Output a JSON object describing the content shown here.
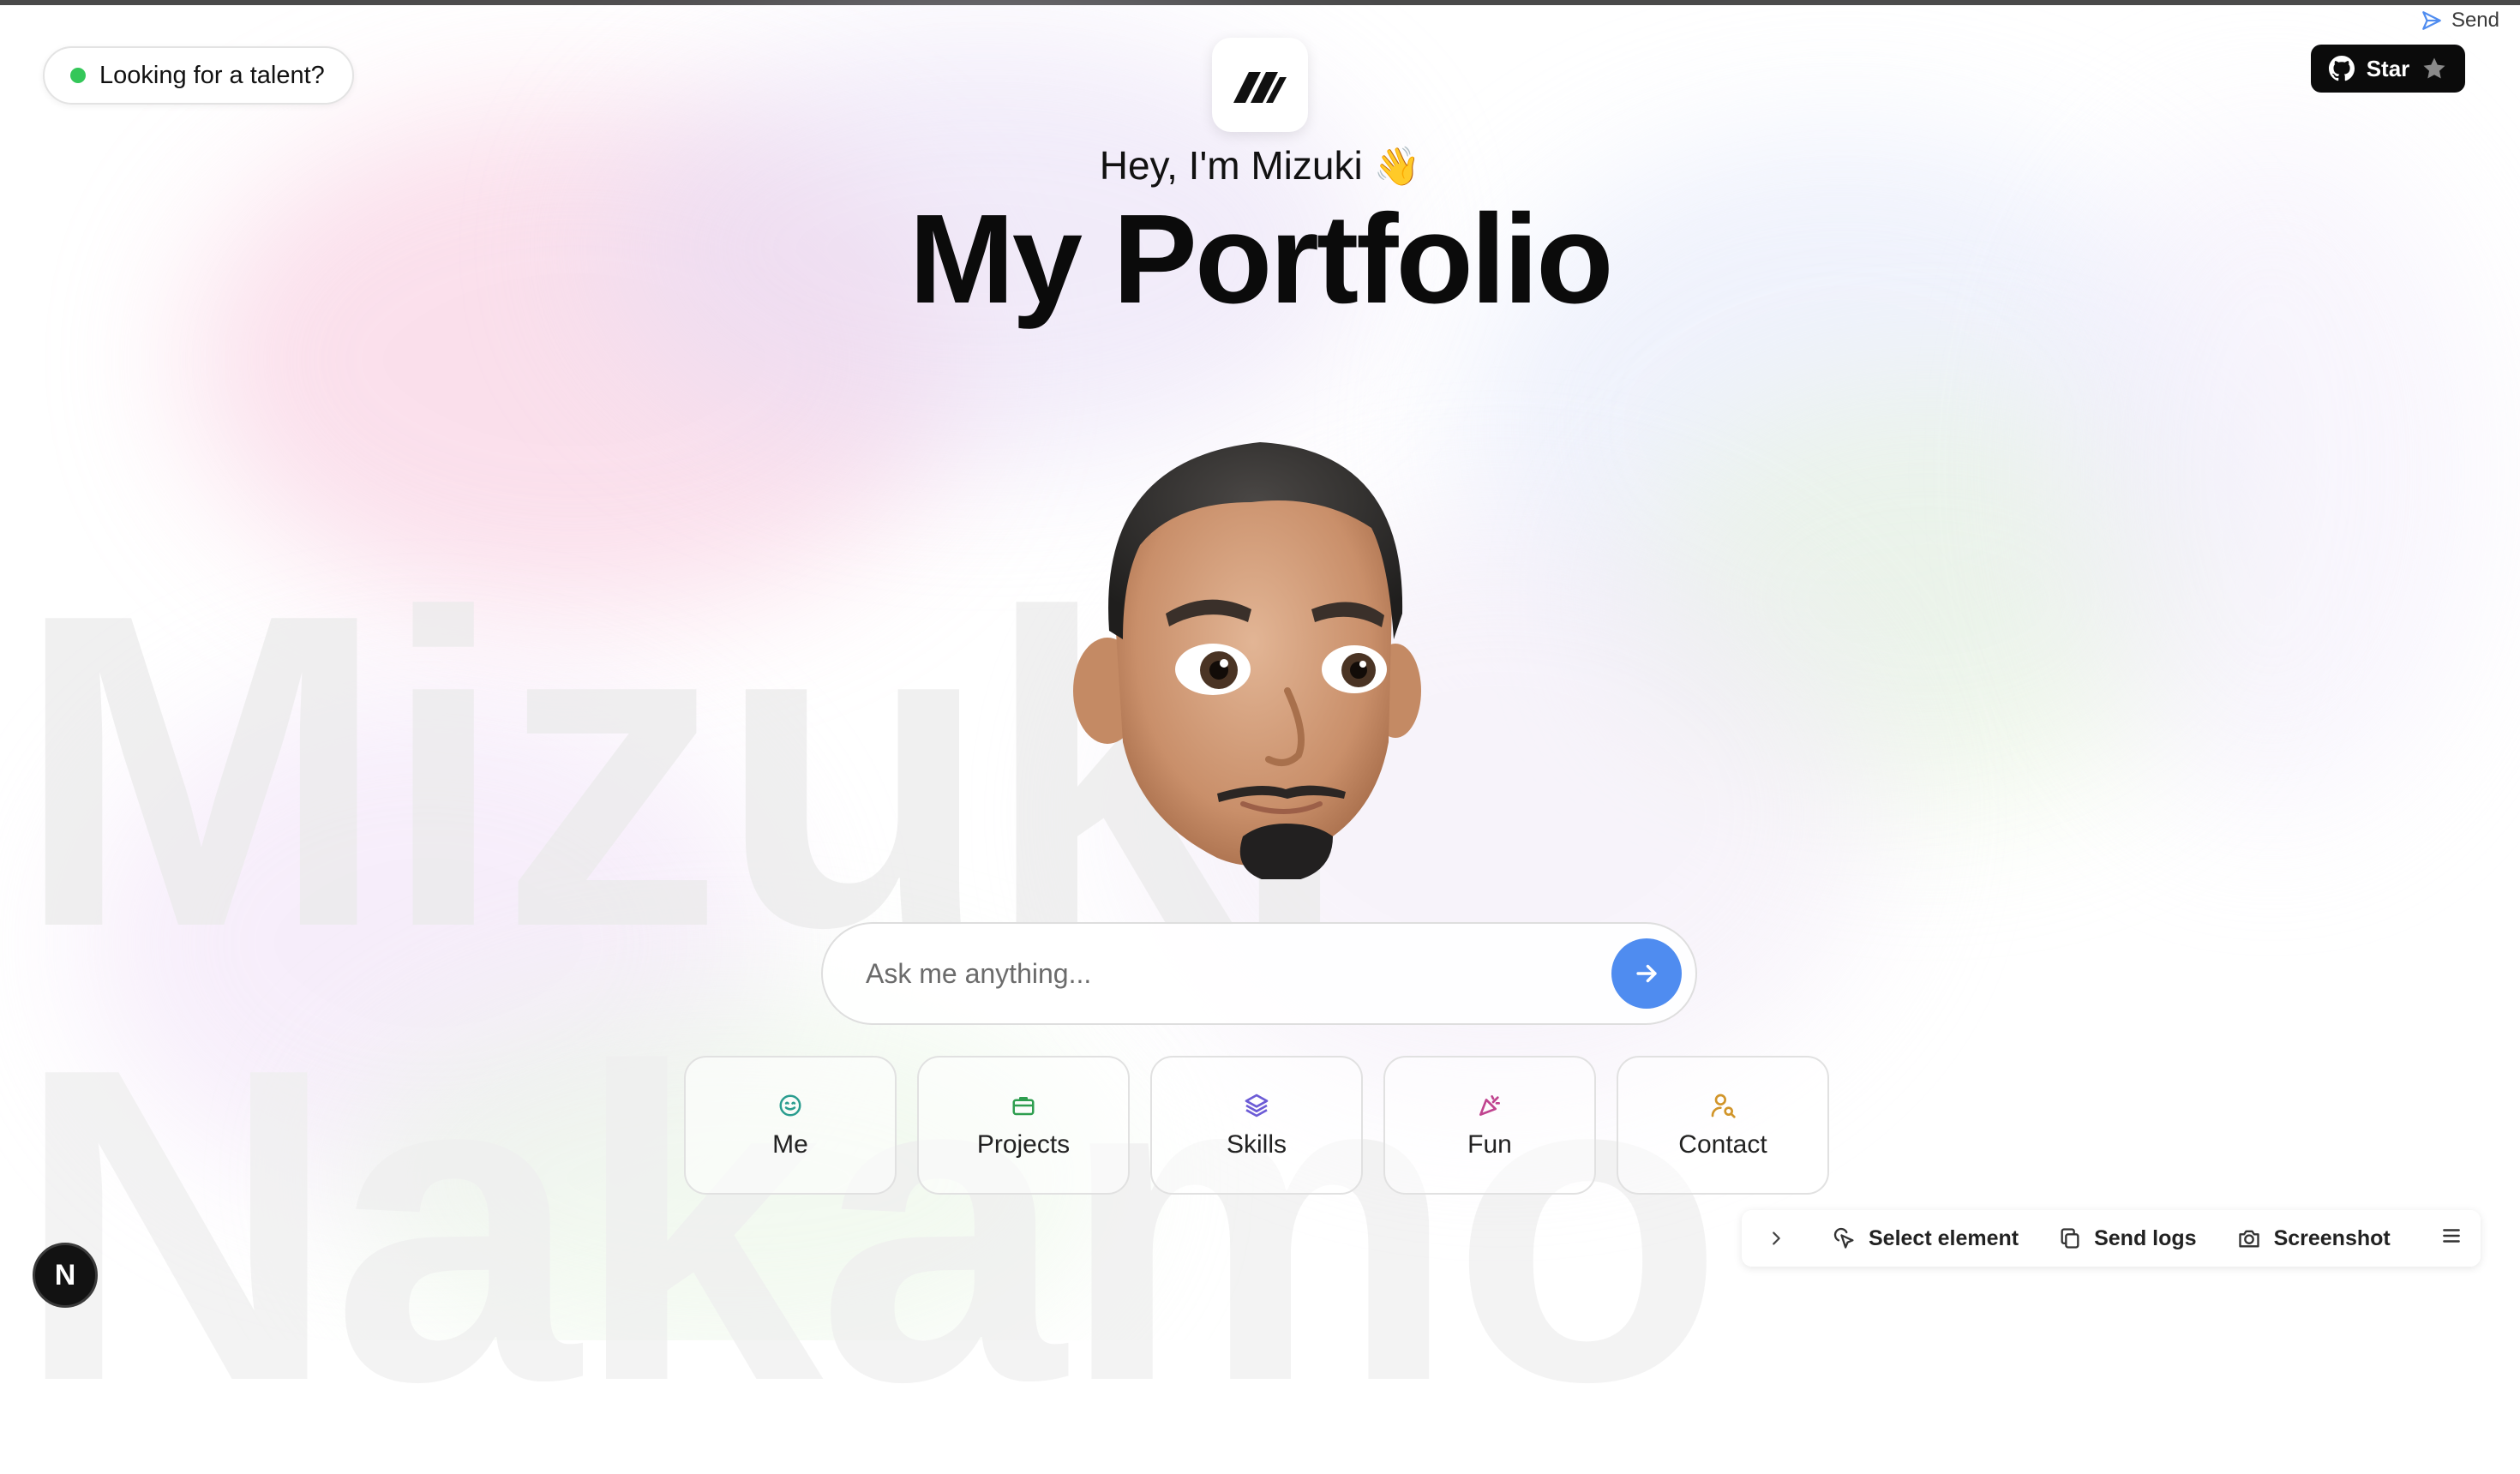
{
  "status_pill": {
    "label": "Looking for a talent?",
    "dot_color": "#34c759"
  },
  "send_tab": {
    "label": "Send"
  },
  "github_star": {
    "label": "Star"
  },
  "logo": {
    "icon": "brand-logo-icon"
  },
  "hero": {
    "greeting": "Hey, I'm Mizuki",
    "wave_emoji": "👋",
    "title": "My Portfolio"
  },
  "background_name": {
    "first": "Mizuki",
    "last": "Nakamo"
  },
  "chat": {
    "placeholder": "Ask me anything...",
    "send_color": "#4f8cf0"
  },
  "quick_actions": [
    {
      "label": "Me",
      "icon": "smiley-icon",
      "color": "#2a9d8f"
    },
    {
      "label": "Projects",
      "icon": "briefcase-icon",
      "color": "#2e9e4f"
    },
    {
      "label": "Skills",
      "icon": "layers-icon",
      "color": "#6c5bd6"
    },
    {
      "label": "Fun",
      "icon": "party-popper-icon",
      "color": "#c0448f"
    },
    {
      "label": "Contact",
      "icon": "user-search-icon",
      "color": "#d1952a"
    }
  ],
  "dev_toolbar": {
    "select_element": "Select element",
    "send_logs": "Send logs",
    "screenshot": "Screenshot"
  },
  "next_badge": {
    "label": "N"
  }
}
